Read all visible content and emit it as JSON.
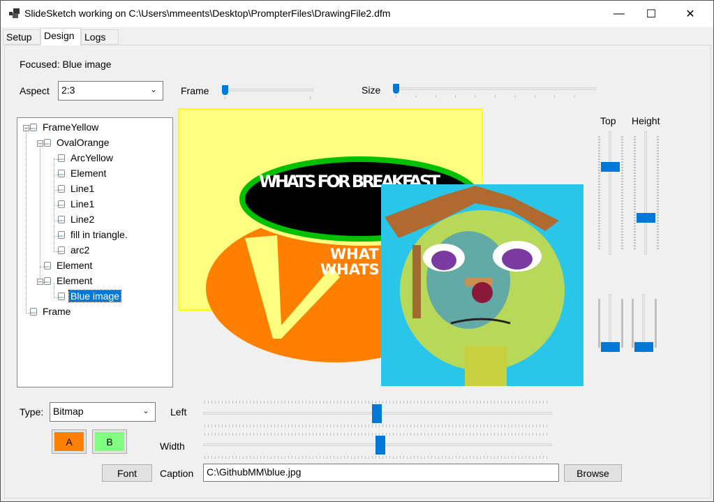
{
  "window": {
    "title": "SlideSketch working on C:\\Users\\mmeents\\Desktop\\PrompterFiles\\DrawingFile2.dfm",
    "minimize": "—",
    "maximize": "☐",
    "close": "✕"
  },
  "tabs": [
    {
      "label": "Setup"
    },
    {
      "label": "Design",
      "active": true
    },
    {
      "label": "Logs"
    }
  ],
  "design": {
    "focused_label": "Focused: Blue image",
    "aspect_label": "Aspect",
    "aspect_value": "2:3",
    "frame_label": "Frame",
    "frame_value_pct": 0,
    "size_label": "Size",
    "size_value_pct": 0,
    "tree": [
      {
        "label": "FrameYellow",
        "level": 0,
        "expanded": true,
        "icon": "frame-icon"
      },
      {
        "label": "OvalOrange",
        "level": 1,
        "expanded": true,
        "icon": "element-icon"
      },
      {
        "label": "ArcYellow",
        "level": 2,
        "icon": "element-icon"
      },
      {
        "label": "Element",
        "level": 2,
        "icon": "element-icon"
      },
      {
        "label": "Line1",
        "level": 2,
        "icon": "element-icon"
      },
      {
        "label": "Line1",
        "level": 2,
        "icon": "element-icon"
      },
      {
        "label": "Line2",
        "level": 2,
        "icon": "element-icon"
      },
      {
        "label": "fill in triangle.",
        "level": 2,
        "icon": "element-icon"
      },
      {
        "label": "arc2",
        "level": 2,
        "icon": "element-icon"
      },
      {
        "label": "Element",
        "level": 1,
        "icon": "element-icon"
      },
      {
        "label": "Element",
        "level": 1,
        "expanded": true,
        "icon": "element-icon"
      },
      {
        "label": "Blue image",
        "level": 2,
        "selected": true,
        "icon": "element-icon"
      },
      {
        "label": "Frame",
        "level": 0,
        "icon": "frame-icon"
      }
    ],
    "canvas": {
      "text1": "WHATS FOR BREAKFAST",
      "text2a": "WHAT",
      "text2b": "WHATS",
      "colors": {
        "frame": "#ffff80",
        "frame_border": "#ffff00",
        "oval": "#ff8000",
        "ring": "#00c000",
        "image_bg": "#29c6ea"
      }
    },
    "top_label": "Top",
    "top_value_pct": 28,
    "height_label": "Height",
    "height_value_pct": 70,
    "lower_slider_1_pct": 100,
    "lower_slider_2_pct": 100,
    "type_label": "Type:",
    "type_value": "Bitmap",
    "left_label": "Left",
    "left_value_pct": 50,
    "width_label": "Width",
    "width_value_pct": 51,
    "color_a": {
      "label": "A",
      "color": "#ff8000"
    },
    "color_b": {
      "label": "B",
      "color": "#80ff80"
    },
    "font_button": "Font",
    "caption_label": "Caption",
    "caption_value": "C:\\GithubMM\\blue.jpg",
    "browse_button": "Browse"
  }
}
